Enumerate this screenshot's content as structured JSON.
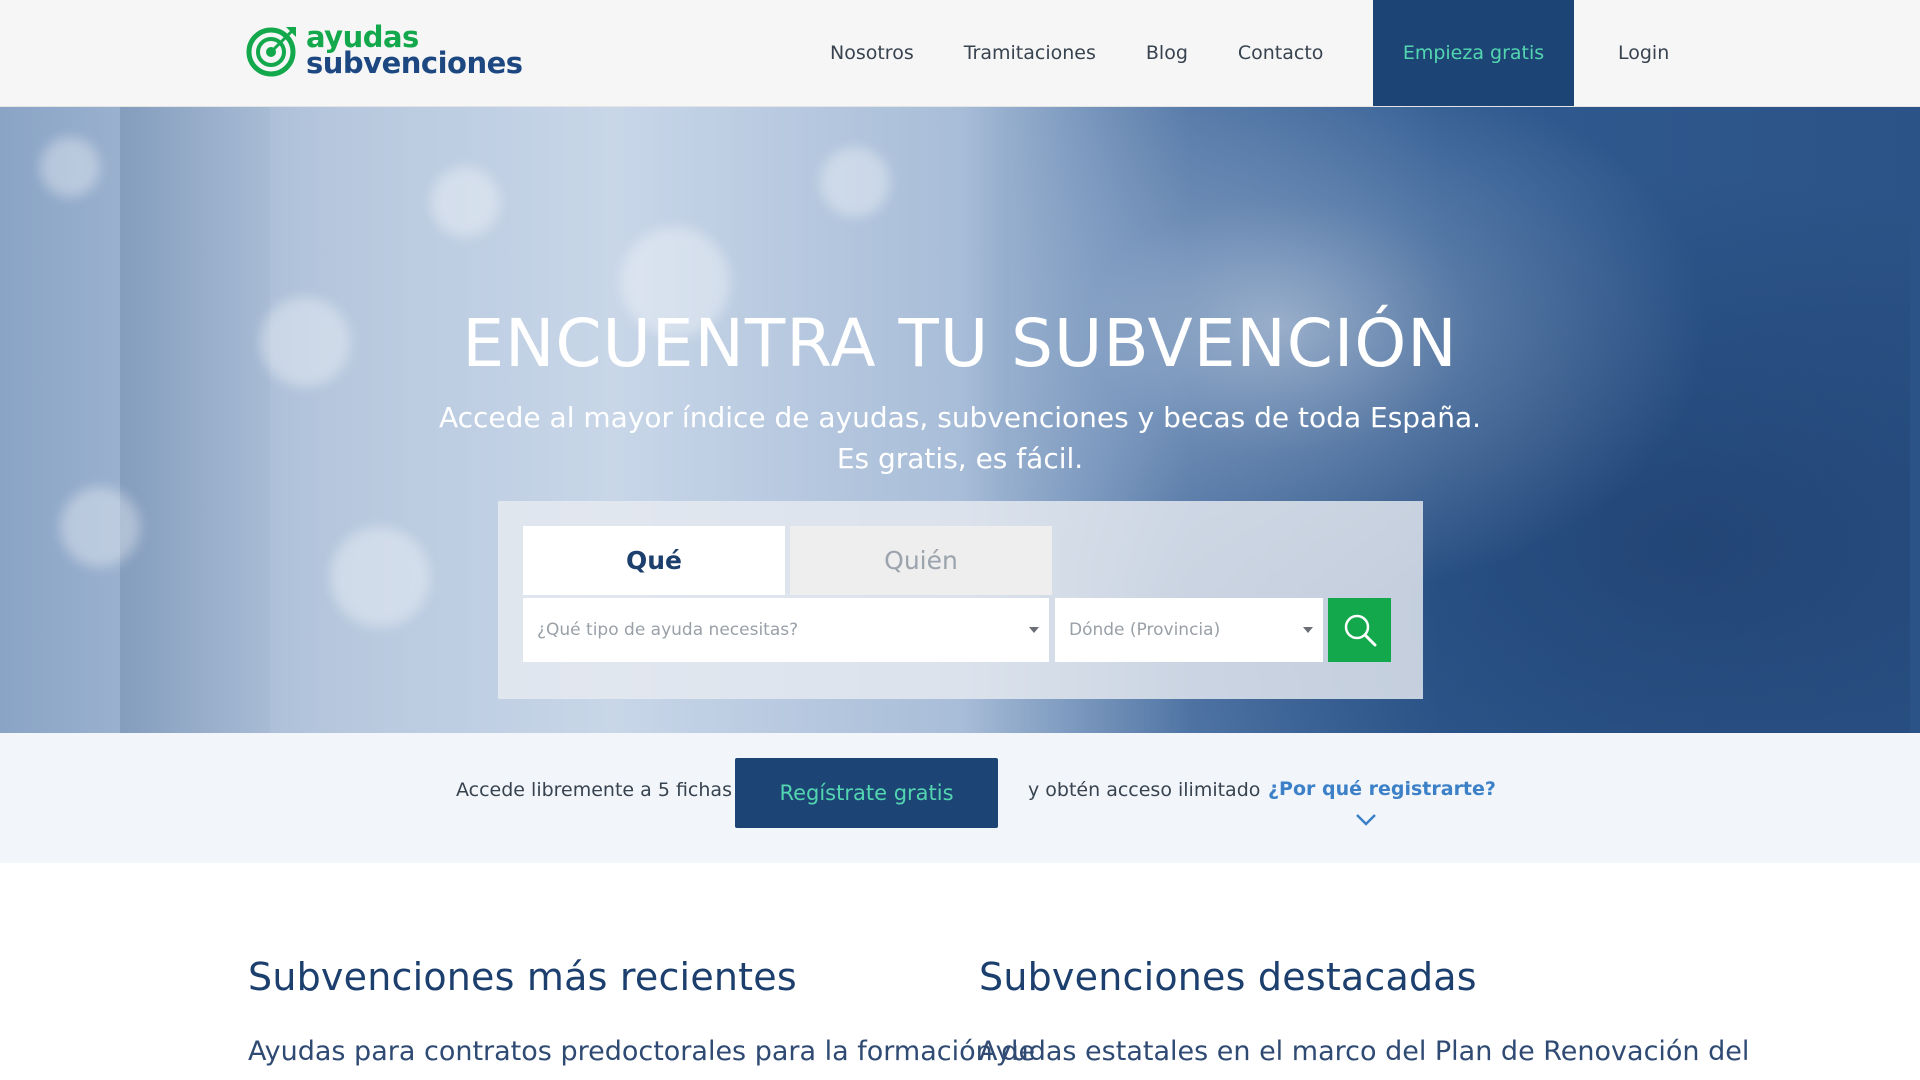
{
  "header": {
    "logo": {
      "line1": "ayudas",
      "line2": "subvenciones"
    },
    "nav": [
      "Nosotros",
      "Tramitaciones",
      "Blog",
      "Contacto"
    ],
    "cta": "Empieza gratis",
    "login": "Login"
  },
  "hero": {
    "title": "ENCUENTRA TU SUBVENCIÓN",
    "subtitle_line1": "Accede al mayor índice de ayudas, subvenciones y becas de toda España.",
    "subtitle_line2": "Es gratis, es fácil.",
    "tabs": {
      "what": "Qué",
      "who": "Quién"
    },
    "select_what_placeholder": "¿Qué tipo de ayuda necesitas?",
    "select_where_placeholder": "Dónde (Provincia)"
  },
  "strip": {
    "text1": "Accede libremente a 5 fichas",
    "register": "Regístrate gratis",
    "text2": "y obtén acceso ilimitado",
    "why": "¿Por qué registrarte?"
  },
  "content": {
    "recent_title": "Subvenciones más recientes",
    "recent_item": "Ayudas para contratos predoctorales para la formación de",
    "featured_title": "Subvenciones destacadas",
    "featured_item": "Ayudas estatales en el marco del Plan de Renovación del"
  },
  "colors": {
    "brand_green": "#13a84b",
    "brand_navy": "#1c4576",
    "cta_text": "#53d6b0",
    "link_blue": "#3c80c8"
  }
}
